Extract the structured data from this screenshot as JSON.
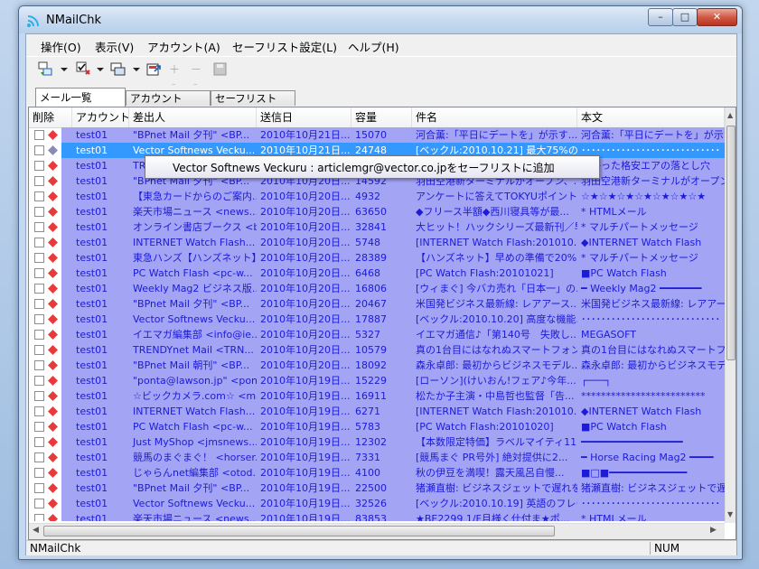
{
  "window": {
    "title": "NMailChk"
  },
  "caption": {
    "minimize": "–",
    "maximize": "□",
    "close": "✕"
  },
  "menu": [
    "操作(O)",
    "表示(V)",
    "アカウント(A)",
    "セーフリスト設定(L)",
    "ヘルプ(H)"
  ],
  "tabs": [
    {
      "label": "メール一覧",
      "active": true
    },
    {
      "label": "アカウント",
      "active": false
    },
    {
      "label": "セーフリスト",
      "active": false
    }
  ],
  "columns": [
    "削除",
    "アカウント",
    "差出人",
    "送信日",
    "容量",
    "件名",
    "本文"
  ],
  "rows": [
    {
      "account": "test01",
      "from": "\"BPnet Mail 夕刊\" <BP...",
      "date": "2010年10月21日...",
      "size": "15070",
      "subject": "河合薫:「平日にデートを」が示す...",
      "body": "河合薫:「平日にデートを」が示す"
    },
    {
      "account": "test01",
      "from": "Vector Softnews Vecku...",
      "date": "2010年10月21日...",
      "size": "24748",
      "subject": "[ベックル:2010.10.21] 最大75%のイ...",
      "body": "････････････････････････････"
    },
    {
      "account": "test01",
      "from": "TR...",
      "date": "2010年10月20日...",
      "size": "",
      "subject": "",
      "body": "分かった格安エアの落とし穴"
    },
    {
      "account": "test01",
      "from": "\"BPnet Mail 夕刊\" <BP...",
      "date": "2010年10月20日...",
      "size": "14592",
      "subject": "羽田空港新ターミナルがオープン、...",
      "body": "羽田空港新ターミナルがオープン、"
    },
    {
      "account": "test01",
      "from": "【東急カードからのご案内...",
      "date": "2010年10月20日...",
      "size": "4932",
      "subject": "アンケートに答えてTOKYUポイント...",
      "body": "☆★☆★☆★☆★☆★☆★☆★"
    },
    {
      "account": "test01",
      "from": "楽天市場ニュース <news...",
      "date": "2010年10月20日...",
      "size": "63650",
      "subject": "◆フリース半額◆西川寝具等が最...",
      "body": "* HTMLメール"
    },
    {
      "account": "test01",
      "from": "オンライン書店ブークス <b...",
      "date": "2010年10月20日...",
      "size": "32841",
      "subject": "大ヒット！ハックシリーズ最新刊／早...",
      "body": "* マルチパートメッセージ"
    },
    {
      "account": "test01",
      "from": "INTERNET Watch Flash...",
      "date": "2010年10月20日...",
      "size": "5748",
      "subject": "[INTERNET Watch Flash:201010...",
      "body": "◆INTERNET Watch Flash"
    },
    {
      "account": "test01",
      "from": "東急ハンズ【ハンズネット】...",
      "date": "2010年10月20日...",
      "size": "28389",
      "subject": "【ハンズネット】早めの準備で20%オ...",
      "body": "* マルチパートメッセージ"
    },
    {
      "account": "test01",
      "from": "PC Watch Flash <pc-w...",
      "date": "2010年10月20日...",
      "size": "6468",
      "subject": "[PC Watch Flash:20101021]",
      "body": "■PC Watch Flash"
    },
    {
      "account": "test01",
      "from": "Weekly Mag2 ビジネス版...",
      "date": "2010年10月20日...",
      "size": "16806",
      "subject": "[ウィまぐ] 今バカ売れ「日本一」の...",
      "body": "━ Weekly Mag2 ━━━━━━━"
    },
    {
      "account": "test01",
      "from": "\"BPnet Mail 夕刊\" <BP...",
      "date": "2010年10月20日...",
      "size": "20467",
      "subject": "米国発ビジネス最新線: レアアース...",
      "body": "米国発ビジネス最新線: レアアース"
    },
    {
      "account": "test01",
      "from": "Vector Softnews Vecku...",
      "date": "2010年10月20日...",
      "size": "17887",
      "subject": "[ベックル:2010.10.20] 高度な機能...",
      "body": "････････････････････････････"
    },
    {
      "account": "test01",
      "from": "イエマガ編集部 <info@ie...",
      "date": "2010年10月20日...",
      "size": "5327",
      "subject": "イエマガ通信♪「第140号　失敗し...",
      "body": "MEGASOFT"
    },
    {
      "account": "test01",
      "from": "TRENDYnet Mail <TRN...",
      "date": "2010年10月20日...",
      "size": "10579",
      "subject": "真の1台目にはなれぬスマートフォン...",
      "body": "真の1台目にはなれぬスマートフォン"
    },
    {
      "account": "test01",
      "from": "\"BPnet Mail 朝刊\" <BP...",
      "date": "2010年10月20日...",
      "size": "18092",
      "subject": "森永卓郎: 最初からビジネスモデル...",
      "body": "森永卓郎: 最初からビジネスモデル"
    },
    {
      "account": "test01",
      "from": "\"ponta@lawson.jp\" <pon...",
      "date": "2010年10月19日...",
      "size": "15229",
      "subject": "[ローソン](けいおん!フェア♪今年...",
      "body": "┌───┐"
    },
    {
      "account": "test01",
      "from": "☆ビックカメラ.com☆ <ma...",
      "date": "2010年10月19日...",
      "size": "16911",
      "subject": "松たか子主演・中島哲也監督「告...",
      "body": "*************************"
    },
    {
      "account": "test01",
      "from": "INTERNET Watch Flash...",
      "date": "2010年10月19日...",
      "size": "6271",
      "subject": "[INTERNET Watch Flash:201010...",
      "body": "◆INTERNET Watch Flash"
    },
    {
      "account": "test01",
      "from": "PC Watch Flash <pc-w...",
      "date": "2010年10月19日...",
      "size": "5783",
      "subject": "[PC Watch Flash:20101020]",
      "body": "■PC Watch Flash"
    },
    {
      "account": "test01",
      "from": "Just MyShop <jmsnews...",
      "date": "2010年10月19日...",
      "size": "12302",
      "subject": "【本数限定特価】ラベルマイティ11...",
      "body": "━━━━━━━━━━━━━━━━━"
    },
    {
      "account": "test01",
      "from": "競馬のまぐまぐ！ <horser...",
      "date": "2010年10月19日...",
      "size": "7331",
      "subject": "[競馬まぐ PR号外] 絶対提供に2...",
      "body": "━ Horse Racing Mag2 ━━━━"
    },
    {
      "account": "test01",
      "from": "じゃらんnet編集部 <otod...",
      "date": "2010年10月19日...",
      "size": "4100",
      "subject": "秋の伊豆を満喫！露天風呂自慢...",
      "body": "■□■━━━━━━━━━━━━━"
    },
    {
      "account": "test01",
      "from": "\"BPnet Mail 夕刊\" <BP...",
      "date": "2010年10月19日...",
      "size": "22500",
      "subject": "猪瀬直樹: ビジネスジェットで遅れを...",
      "body": "猪瀬直樹: ビジネスジェットで遅れを"
    },
    {
      "account": "test01",
      "from": "Vector Softnews Vecku...",
      "date": "2010年10月19日...",
      "size": "32526",
      "subject": "[ベックル:2010.10.19] 英語のフレー...",
      "body": "････････････････････････････"
    },
    {
      "account": "test01",
      "from": "楽天市場ニュース <news...",
      "date": "2010年10月19日...",
      "size": "83853",
      "subject": "★BE2299 1/F月様く仕付ま★ポ...",
      "body": "* HTMLメール"
    }
  ],
  "tooltip": "Vector Softnews Veckuru : articlemgr@vector.co.jpをセーフリストに追加",
  "status": {
    "left": "NMailChk",
    "num": "NUM"
  }
}
